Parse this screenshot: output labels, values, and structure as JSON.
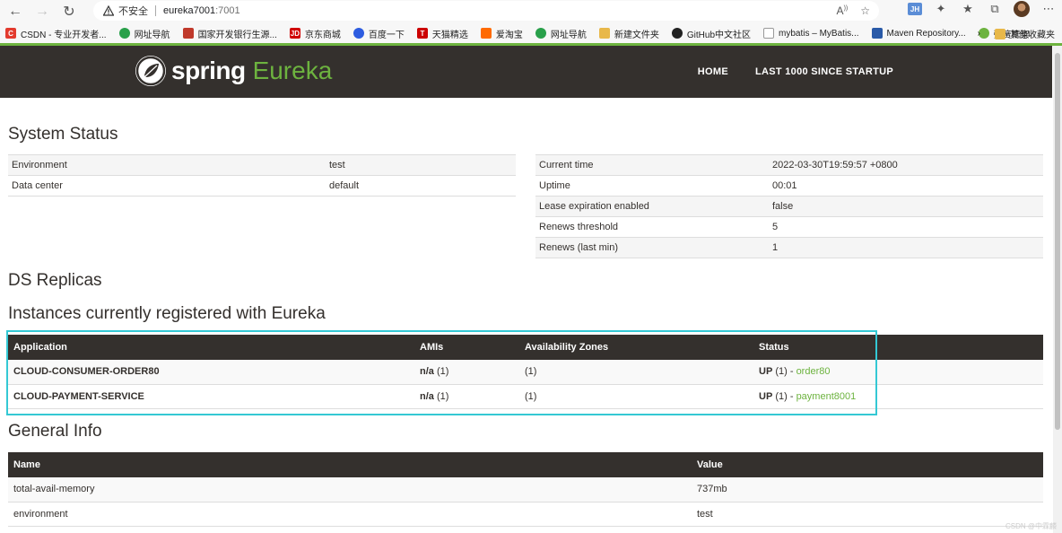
{
  "browser": {
    "insecure_label": "不安全",
    "url_host": "eureka7001",
    "url_port": ":7001",
    "bookmarks": [
      {
        "label": "CSDN - 专业开发者...",
        "color": "#e33b2e",
        "icon": "C"
      },
      {
        "label": "网址导航",
        "color": "#29a04a",
        "icon": ""
      },
      {
        "label": "国家开发银行生源...",
        "color": "#c0392b",
        "icon": ""
      },
      {
        "label": "京东商城",
        "color": "#d00000",
        "icon": "JD"
      },
      {
        "label": "百度一下",
        "color": "#2d5ce0",
        "icon": ""
      },
      {
        "label": "天猫精选",
        "color": "#c00",
        "icon": "T"
      },
      {
        "label": "爱淘宝",
        "color": "#ff6a00",
        "icon": ""
      },
      {
        "label": "网址导航",
        "color": "#29a04a",
        "icon": ""
      },
      {
        "label": "新建文件夹",
        "color": "#e8b84a",
        "icon": ""
      },
      {
        "label": "GitHub中文社区",
        "color": "#222",
        "icon": ""
      },
      {
        "label": "mybatis – MyBatis...",
        "color": "#fff",
        "icon": ""
      },
      {
        "label": "Maven Repository...",
        "color": "#2a5aa8",
        "icon": ""
      },
      {
        "label": "弹簧框架",
        "color": "#6db33f",
        "icon": ""
      }
    ],
    "other_bookmarks": "其他收藏夹"
  },
  "header": {
    "logo_spring": "spring",
    "logo_eureka": "Eureka",
    "nav": [
      "HOME",
      "LAST 1000 SINCE STARTUP"
    ]
  },
  "system_status": {
    "title": "System Status",
    "left": [
      {
        "key": "Environment",
        "value": "test"
      },
      {
        "key": "Data center",
        "value": "default"
      }
    ],
    "right": [
      {
        "key": "Current time",
        "value": "2022-03-30T19:59:57 +0800"
      },
      {
        "key": "Uptime",
        "value": "00:01"
      },
      {
        "key": "Lease expiration enabled",
        "value": "false"
      },
      {
        "key": "Renews threshold",
        "value": "5"
      },
      {
        "key": "Renews (last min)",
        "value": "1"
      }
    ]
  },
  "ds_replicas": {
    "title": "DS Replicas"
  },
  "instances": {
    "title": "Instances currently registered with Eureka",
    "headers": [
      "Application",
      "AMIs",
      "Availability Zones",
      "Status"
    ],
    "rows": [
      {
        "app": "CLOUD-CONSUMER-ORDER80",
        "amis_bold": "n/a",
        "amis_count": " (1)",
        "zones": "(1)",
        "status": "UP",
        "status_count": " (1) - ",
        "instance": "order80"
      },
      {
        "app": "CLOUD-PAYMENT-SERVICE",
        "amis_bold": "n/a",
        "amis_count": " (1)",
        "zones": "(1)",
        "status": "UP",
        "status_count": " (1) - ",
        "instance": "payment8001"
      }
    ]
  },
  "general_info": {
    "title": "General Info",
    "headers": [
      "Name",
      "Value"
    ],
    "rows": [
      {
        "name": "total-avail-memory",
        "value": "737mb"
      },
      {
        "name": "environment",
        "value": "test"
      }
    ]
  },
  "watermark": "CSDN @中霖麟"
}
